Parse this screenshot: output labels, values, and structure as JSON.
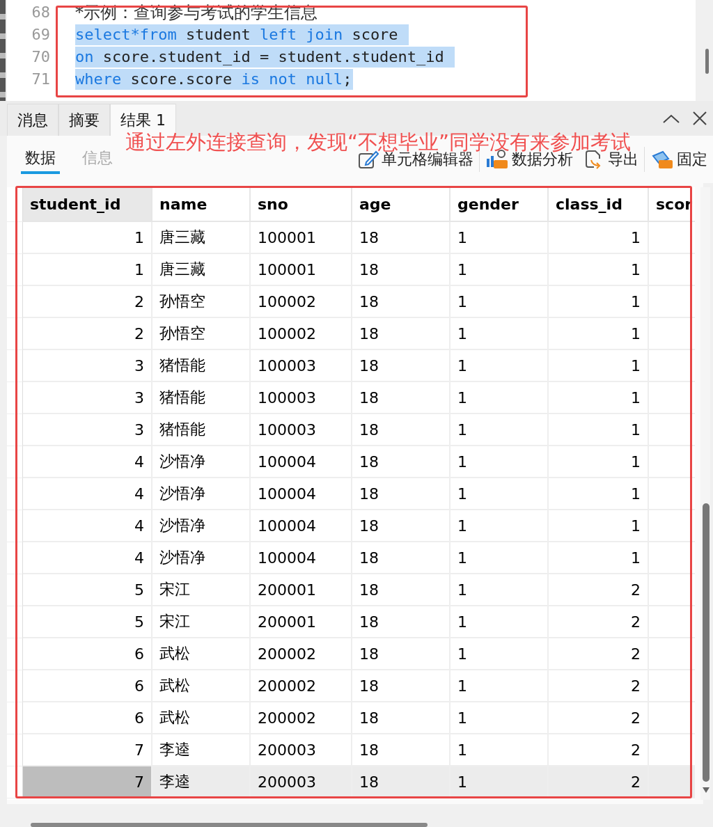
{
  "editor": {
    "lines": [
      {
        "number": "68",
        "selected": false,
        "tokens": [
          {
            "kind": "comment",
            "text": "*示例：查询参与考试的学生信息"
          }
        ]
      },
      {
        "number": "69",
        "selected": true,
        "tokens": [
          {
            "kind": "keyword",
            "text": "select*from"
          },
          {
            "kind": "plain",
            "text": " student "
          },
          {
            "kind": "keyword",
            "text": "left join"
          },
          {
            "kind": "plain",
            "text": " score "
          }
        ]
      },
      {
        "number": "70",
        "selected": true,
        "tokens": [
          {
            "kind": "keyword",
            "text": "on"
          },
          {
            "kind": "plain",
            "text": " score.student_id = student.student_id "
          }
        ]
      },
      {
        "number": "71",
        "selected": true,
        "tokens": [
          {
            "kind": "keyword",
            "text": "where"
          },
          {
            "kind": "plain",
            "text": " score.score "
          },
          {
            "kind": "keyword",
            "text": "is not null"
          },
          {
            "kind": "plain",
            "text": ";"
          }
        ]
      }
    ]
  },
  "tabs": [
    {
      "label": "消息",
      "selected": false
    },
    {
      "label": "摘要",
      "selected": false
    },
    {
      "label": "结果 1",
      "selected": true
    }
  ],
  "subtabs": [
    {
      "label": "数据",
      "selected": true
    },
    {
      "label": "信息",
      "selected": false
    }
  ],
  "toolbar": [
    {
      "kind": "edit",
      "label": "单元格编辑器"
    },
    {
      "kind": "analyze",
      "label": "数据分析"
    },
    {
      "kind": "export",
      "label": "导出"
    },
    {
      "kind": "pin",
      "label": "固定"
    }
  ],
  "annotation": "通过左外连接查询，发现“不想毕业”同学没有来参加考试",
  "table": {
    "columns": [
      "student_id",
      "name",
      "sno",
      "age",
      "gender",
      "class_id",
      "scor"
    ],
    "rows": [
      {
        "cells": [
          "1",
          "唐三藏",
          "100001",
          "18",
          "1",
          "1"
        ],
        "selected": false
      },
      {
        "cells": [
          "1",
          "唐三藏",
          "100001",
          "18",
          "1",
          "1"
        ],
        "selected": false
      },
      {
        "cells": [
          "2",
          "孙悟空",
          "100002",
          "18",
          "1",
          "1"
        ],
        "selected": false
      },
      {
        "cells": [
          "2",
          "孙悟空",
          "100002",
          "18",
          "1",
          "1"
        ],
        "selected": false
      },
      {
        "cells": [
          "3",
          "猪悟能",
          "100003",
          "18",
          "1",
          "1"
        ],
        "selected": false
      },
      {
        "cells": [
          "3",
          "猪悟能",
          "100003",
          "18",
          "1",
          "1"
        ],
        "selected": false
      },
      {
        "cells": [
          "3",
          "猪悟能",
          "100003",
          "18",
          "1",
          "1"
        ],
        "selected": false
      },
      {
        "cells": [
          "4",
          "沙悟净",
          "100004",
          "18",
          "1",
          "1"
        ],
        "selected": false
      },
      {
        "cells": [
          "4",
          "沙悟净",
          "100004",
          "18",
          "1",
          "1"
        ],
        "selected": false
      },
      {
        "cells": [
          "4",
          "沙悟净",
          "100004",
          "18",
          "1",
          "1"
        ],
        "selected": false
      },
      {
        "cells": [
          "4",
          "沙悟净",
          "100004",
          "18",
          "1",
          "1"
        ],
        "selected": false
      },
      {
        "cells": [
          "5",
          "宋江",
          "200001",
          "18",
          "1",
          "2"
        ],
        "selected": false
      },
      {
        "cells": [
          "5",
          "宋江",
          "200001",
          "18",
          "1",
          "2"
        ],
        "selected": false
      },
      {
        "cells": [
          "6",
          "武松",
          "200002",
          "18",
          "1",
          "2"
        ],
        "selected": false
      },
      {
        "cells": [
          "6",
          "武松",
          "200002",
          "18",
          "1",
          "2"
        ],
        "selected": false
      },
      {
        "cells": [
          "6",
          "武松",
          "200002",
          "18",
          "1",
          "2"
        ],
        "selected": false
      },
      {
        "cells": [
          "7",
          "李逵",
          "200003",
          "18",
          "1",
          "2"
        ],
        "selected": false
      },
      {
        "cells": [
          "7",
          "李逵",
          "200003",
          "18",
          "1",
          "2"
        ],
        "selected": true
      }
    ]
  }
}
